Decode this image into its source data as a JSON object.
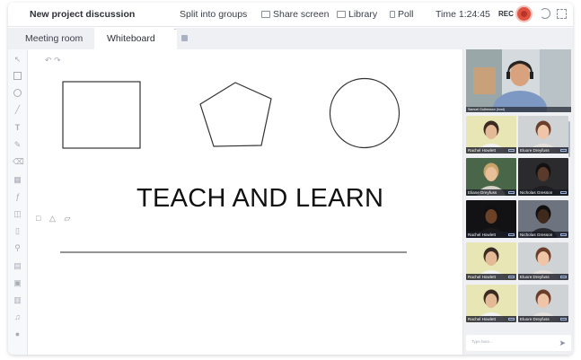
{
  "topbar": {
    "title": "New project discussion",
    "split_label": "Split into groups",
    "share_label": "Share screen",
    "library_label": "Library",
    "poll_label": "Poll",
    "time_label": "Time 1:24:45",
    "rec_label": "REC",
    "icons": [
      "screen-icon",
      "library-icon",
      "poll-icon",
      "record-icon",
      "exit-icon",
      "fullscreen-icon"
    ]
  },
  "tabs": {
    "items": [
      "Meeting room",
      "Whiteboard"
    ],
    "active": "Whiteboard",
    "close_glyph": "ˆ"
  },
  "toolbar": {
    "icons": [
      "select-icon",
      "rectangle-icon",
      "circle-icon",
      "line-icon",
      "text-icon",
      "pen-icon",
      "eraser-icon",
      "table-icon",
      "formula-icon",
      "shapes-icon",
      "clipboard-icon",
      "zoom-icon",
      "layers-icon",
      "library-icon",
      "chart-icon",
      "music-icon",
      "settings-icon"
    ]
  },
  "whiteboard": {
    "text": "TEACH AND LEARN",
    "undo_glyphs": [
      "↶",
      "↷"
    ],
    "shape_tools": [
      "□",
      "△",
      "▱"
    ]
  },
  "participants": {
    "presenter_name": "Samuel Guthenson (host)",
    "tiles": [
      {
        "name": "Rachel Howlett",
        "bg": "#e8e6b4",
        "skin": "#e3b996",
        "hair": "#3a2a22",
        "shirt": "#f2f2f2"
      },
      {
        "name": "Eluore Dreyfuss",
        "bg": "#cfd3d6",
        "skin": "#f0c4a6",
        "hair": "#6a3e2a",
        "shirt": "#e5e0dc"
      },
      {
        "name": "Eliane Dreyfuss",
        "bg": "#4a6648",
        "skin": "#e7c09a",
        "hair": "#c9a46a",
        "shirt": "#d3d1c8"
      },
      {
        "name": "Nicholas Gresson",
        "bg": "#2b2a2c",
        "skin": "#5a3a2a",
        "hair": "#141112",
        "shirt": "#1e1e22"
      },
      {
        "name": "Rachel Howlett",
        "bg": "#121214",
        "skin": "#6b4228",
        "hair": "#120f10",
        "shirt": "#1a1a1c"
      },
      {
        "name": "Nicholas Gresson",
        "bg": "#6d747f",
        "skin": "#3f281c",
        "hair": "#120f10",
        "shirt": "#2a2a2e"
      },
      {
        "name": "Rachel Howlett",
        "bg": "#e8e6b4",
        "skin": "#e3b996",
        "hair": "#3a2a22",
        "shirt": "#f2f2f2"
      },
      {
        "name": "Eluore Dreyfuss",
        "bg": "#cfd3d6",
        "skin": "#f0c4a6",
        "hair": "#6a3e2a",
        "shirt": "#e5e0dc"
      },
      {
        "name": "Rachel Howlett",
        "bg": "#e8e6b4",
        "skin": "#e3b996",
        "hair": "#3a2a22",
        "shirt": "#f2f2f2"
      },
      {
        "name": "Eluore Dreyfuss",
        "bg": "#cfd3d6",
        "skin": "#f0c4a6",
        "hair": "#6a3e2a",
        "shirt": "#e5e0dc"
      }
    ]
  },
  "chat": {
    "placeholder": "Type here...",
    "send_glyph": "➤"
  },
  "colors": {
    "accent": "#e0523f",
    "toolbar_icon": "#a7acb5"
  }
}
